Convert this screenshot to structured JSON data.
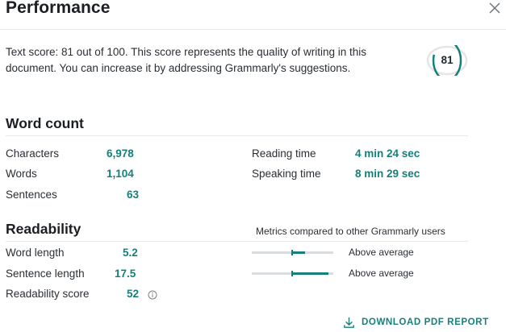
{
  "header": {
    "title": "Performance",
    "close_icon": "close-icon"
  },
  "score": {
    "text": "Text score: 81 out of 100. This score represents the quality of writing in this document. You can increase it by addressing Grammarly's suggestions.",
    "value": "81",
    "fraction": 0.81
  },
  "word_count": {
    "title": "Word count",
    "left": [
      {
        "label": "Characters",
        "value": "6,978"
      },
      {
        "label": "Words",
        "value": "1,104"
      },
      {
        "label": "Sentences",
        "value": "63"
      }
    ],
    "right": [
      {
        "label": "Reading time",
        "value": "4 min 24 sec"
      },
      {
        "label": "Speaking time",
        "value": "8 min 29 sec"
      }
    ]
  },
  "readability": {
    "title": "Readability",
    "note": "Metrics compared to other Grammarly users",
    "rows": [
      {
        "label": "Word length",
        "value": "5.2",
        "comparison": "Above average",
        "level": 0.65
      },
      {
        "label": "Sentence length",
        "value": "17.5",
        "comparison": "Above average",
        "level": 0.94
      },
      {
        "label": "Readability score",
        "value": "52",
        "icon": "info-icon"
      }
    ]
  },
  "footer": {
    "download_label": "DOWNLOAD PDF REPORT",
    "download_icon": "download-icon"
  },
  "colors": {
    "accent": "#15807a",
    "track": "#d9dde0"
  }
}
